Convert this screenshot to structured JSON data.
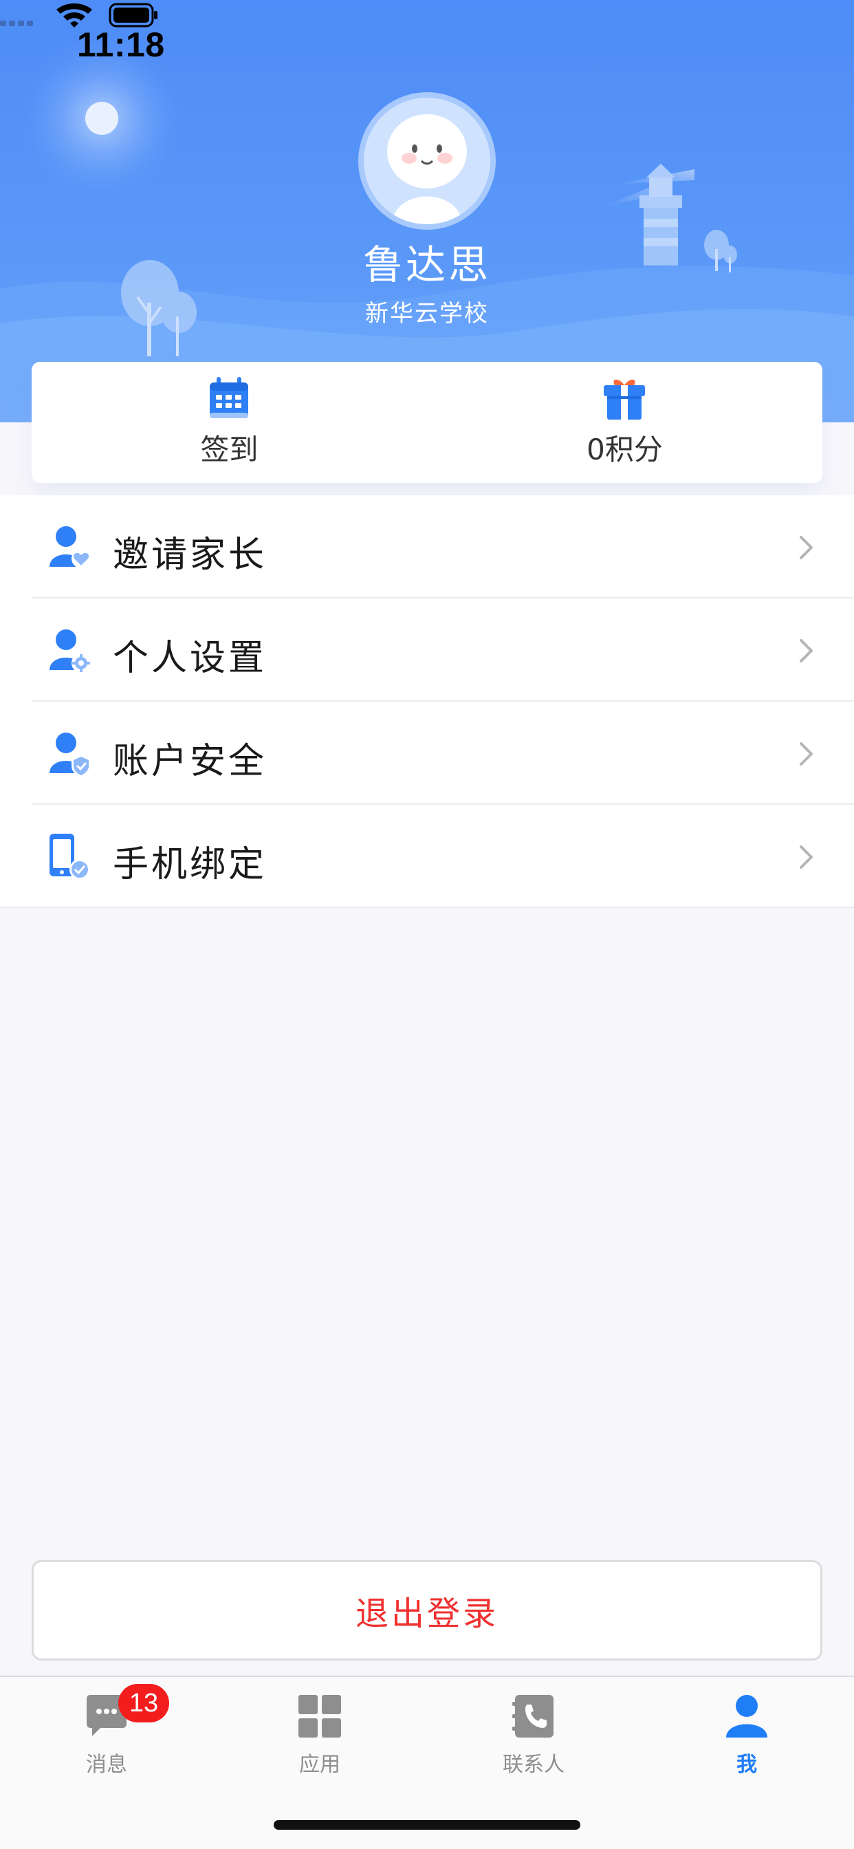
{
  "status_bar": {
    "time": "11:18"
  },
  "profile": {
    "name": "鲁达思",
    "school": "新华云学校"
  },
  "quick_actions": [
    {
      "label": "签到",
      "icon": "calendar-icon"
    },
    {
      "label": "0积分",
      "icon": "gift-icon"
    }
  ],
  "menu": [
    {
      "label": "邀请家长",
      "icon": "user-heart-icon"
    },
    {
      "label": "个人设置",
      "icon": "user-gear-icon"
    },
    {
      "label": "账户安全",
      "icon": "user-shield-icon"
    },
    {
      "label": "手机绑定",
      "icon": "phone-check-icon"
    }
  ],
  "logout": {
    "label": "退出登录"
  },
  "tabbar": {
    "items": [
      {
        "label": "消息",
        "icon": "chat-icon",
        "badge": "13",
        "active": false
      },
      {
        "label": "应用",
        "icon": "grid-icon",
        "active": false
      },
      {
        "label": "联系人",
        "icon": "contacts-phone-icon",
        "active": false
      },
      {
        "label": "我",
        "icon": "person-icon",
        "active": true
      }
    ]
  },
  "colors": {
    "accent": "#1f7ef6",
    "header": "#4e8cf7",
    "danger": "#f03030",
    "badge": "#f41d1d"
  }
}
